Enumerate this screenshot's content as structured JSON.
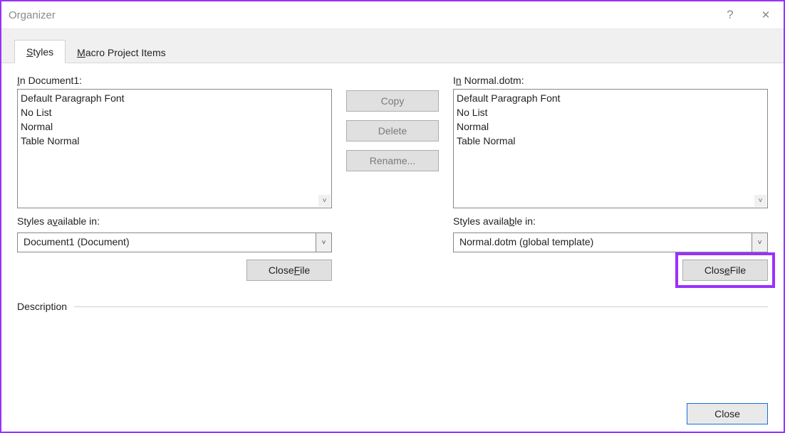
{
  "window": {
    "title": "Organizer"
  },
  "tabs": {
    "styles": "Styles",
    "macros": "Macro Project Items"
  },
  "left": {
    "in_label_prefix": "I",
    "in_label_rest": "n Document1:",
    "items": [
      "Default Paragraph Font",
      "No List",
      "Normal",
      "Table Normal"
    ],
    "avail_prefix": "Styles a",
    "avail_mn": "v",
    "avail_rest": "ailable in:",
    "combo": "Document1 (Document)",
    "close_file_pre": "Close ",
    "close_file_mn": "F",
    "close_file_post": "ile"
  },
  "right": {
    "in_label_prefix": "I",
    "in_label_rest": "n Normal.dotm:",
    "items": [
      "Default Paragraph Font",
      "No List",
      "Normal",
      "Table Normal"
    ],
    "avail_prefix": "Styles availa",
    "avail_mn": "b",
    "avail_rest": "le in:",
    "combo": "Normal.dotm (global template)",
    "close_file_pre": "Clos",
    "close_file_mn": "e",
    "close_file_post": " File"
  },
  "mid": {
    "copy": "Copy",
    "delete": "Delete",
    "rename": "Rename..."
  },
  "description_label": "Description",
  "close_label": "Close"
}
